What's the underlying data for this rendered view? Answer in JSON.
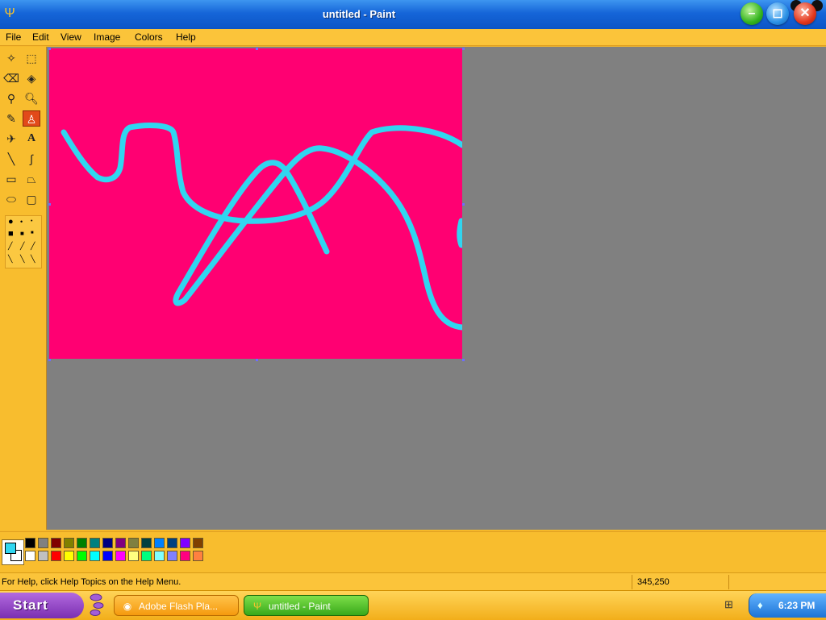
{
  "window": {
    "title": "untitled - Paint"
  },
  "menu": [
    "File",
    "Edit",
    "View",
    "Image",
    "Colors",
    "Help"
  ],
  "canvas": {
    "background": "#ff0072",
    "stroke_color": "#30d6f0"
  },
  "palette": {
    "foreground": "#30d6f0",
    "background": "#ffffff",
    "top_row": [
      "#000000",
      "#808080",
      "#800000",
      "#808000",
      "#008000",
      "#008080",
      "#000080",
      "#800080",
      "#808040",
      "#004040",
      "#0080ff",
      "#004080",
      "#8000ff",
      "#804000"
    ],
    "bottom_row": [
      "#ffffff",
      "#c0c0c0",
      "#ff0000",
      "#ffff00",
      "#00ff00",
      "#00ffff",
      "#0000ff",
      "#ff00ff",
      "#ffff80",
      "#00ff80",
      "#80ffff",
      "#8080ff",
      "#ff0080",
      "#ff8040"
    ]
  },
  "status": {
    "help_text": "For Help, click Help Topics on the Help Menu.",
    "coords": "345,250"
  },
  "taskbar": {
    "start_label": "Start",
    "tasks": [
      "Adobe Flash Pla...",
      "untitled - Paint"
    ],
    "clock": "6:23 PM"
  }
}
